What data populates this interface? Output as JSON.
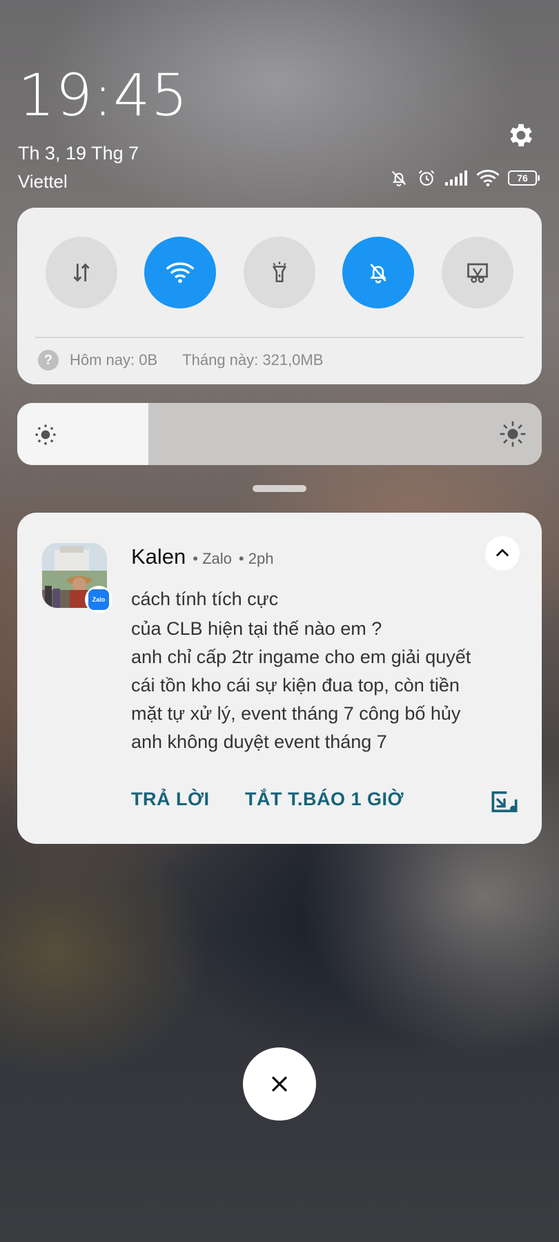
{
  "status": {
    "time": "19:45",
    "date": "Th 3, 19 Thg 7",
    "carrier": "Viettel",
    "battery": "76"
  },
  "quick_settings": {
    "tiles": [
      {
        "name": "mobile-data",
        "active": false
      },
      {
        "name": "wifi",
        "active": true
      },
      {
        "name": "flashlight",
        "active": false
      },
      {
        "name": "silent",
        "active": true
      },
      {
        "name": "screenshot",
        "active": false
      }
    ],
    "data_today": "Hôm nay: 0B",
    "data_month": "Tháng này: 321,0MB"
  },
  "brightness": {
    "level": 0.25
  },
  "notification": {
    "sender": "Kalen",
    "app": "• Zalo",
    "time": "• 2ph",
    "badge": "Zalo",
    "lines": [
      "cách tính tích cực",
      "của CLB hiện tại thế nào em ?",
      "anh chỉ cấp 2tr ingame cho em giải quyết",
      "cái tồn kho cái sự kiện đua top, còn tiền",
      "mặt tự xử lý, event tháng 7 công bố hủy",
      "anh không duyệt event tháng 7"
    ],
    "actions": {
      "reply": "TRẢ LỜI",
      "mute": "TẮT T.BÁO 1 GIỜ"
    }
  }
}
